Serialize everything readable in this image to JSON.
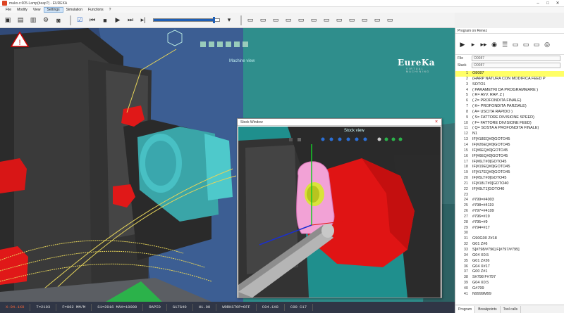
{
  "window": {
    "title": "mako.c:605-Lamp(beap?) - EUREKA"
  },
  "menu": [
    {
      "label": "File",
      "active": false
    },
    {
      "label": "Modify",
      "active": false
    },
    {
      "label": "View",
      "active": false
    },
    {
      "label": "Settings",
      "active": true
    },
    {
      "label": "Simulation",
      "active": false
    },
    {
      "label": "Functions",
      "active": false
    },
    {
      "label": "?",
      "active": false
    }
  ],
  "toolbar": {
    "icons": [
      "folder-open-icon",
      "save-icon",
      "print-icon",
      "settings-icon",
      "camera-icon",
      "check-icon",
      "rewind-icon",
      "stop-icon",
      "play-icon",
      "fast-forward-icon",
      "step-icon"
    ],
    "progress": 0.92,
    "right_icons": [
      "doc-icon",
      "doc-icon",
      "doc-icon",
      "doc-icon",
      "doc-icon",
      "doc-icon",
      "doc-icon",
      "doc-icon",
      "doc-icon",
      "doc-icon",
      "doc-icon",
      "doc-icon"
    ]
  },
  "viewport": {
    "label": "Machine view",
    "logo_brand": "EureKa",
    "logo_sub": "VIRTUAL MACHINING",
    "accent_color": "#2f8e8c"
  },
  "stock_window": {
    "title": "Stock Window",
    "close_label": "×",
    "view_label": "Stock view"
  },
  "status": [
    "X-04.1X0",
    "T=2103",
    "F=862 MM/M",
    "S1=2016 MAX=10000",
    "RAPID",
    "G17G40",
    "H1.00",
    "WORKSTOP=OFF",
    "C04.1X8",
    "C00 C17"
  ],
  "panel": {
    "title": "Program on Renez",
    "file_label": "File",
    "file_value": "O0087",
    "stack_label": "Stack",
    "stack_value": "O0087",
    "code": [
      {
        "n": "1",
        "t": "O8087",
        "current": true
      },
      {
        "n": "2",
        "t": "(HARP NATURA CON MODIFICA FEED P",
        "current": false
      },
      {
        "n": "3",
        "t": "SOTO1",
        "current": false
      },
      {
        "n": "4",
        "t": "( PARAMETRI DA PROGRAMMARE )",
        "current": false
      },
      {
        "n": "5",
        "t": "( R= AVV. RAP. Z )",
        "current": false
      },
      {
        "n": "6",
        "t": "( Z= PROFONDITA FINALE)",
        "current": false
      },
      {
        "n": "7",
        "t": "( K= PROFONDITA PARZIALE)",
        "current": false
      },
      {
        "n": "8",
        "t": "( A= USCITA RAPIDO )",
        "current": false
      },
      {
        "n": "9",
        "t": "( S= FATTORE DIVISIONE SPEED)",
        "current": false
      },
      {
        "n": "10",
        "t": "( F= FATTORE DIVISIONE FEED)",
        "current": false
      },
      {
        "n": "11",
        "t": "( Q= SOSTA A PROFONDITA FINALE)",
        "current": false
      },
      {
        "n": "12",
        "t": "N1",
        "current": false
      },
      {
        "n": "13",
        "t": "IF[#18EQ#0]GOTO45",
        "current": false
      },
      {
        "n": "14",
        "t": "IF[#26EQ#0]GOTO45",
        "current": false
      },
      {
        "n": "15",
        "t": "IF[#6EQ#0]GOTO45",
        "current": false
      },
      {
        "n": "16",
        "t": "IF[#6EQ#0]GOTO45",
        "current": false
      },
      {
        "n": "17",
        "t": "IF[#6LT#0]GOTO45",
        "current": false
      },
      {
        "n": "18",
        "t": "IF[#19EQ#0]GOTO45",
        "current": false
      },
      {
        "n": "19",
        "t": "IF[#17EQ#0]GOTO45",
        "current": false
      },
      {
        "n": "20",
        "t": "IF[#5LT#0]GOTO45",
        "current": false
      },
      {
        "n": "21",
        "t": "IF[#18LT#0]GOTO40",
        "current": false
      },
      {
        "n": "22",
        "t": "IF[#9LT1]GOTO40",
        "current": false
      },
      {
        "n": "23",
        "t": "",
        "current": false
      },
      {
        "n": "24",
        "t": "#799=#4003",
        "current": false
      },
      {
        "n": "25",
        "t": "#798=#4119",
        "current": false
      },
      {
        "n": "26",
        "t": "#797=#4109",
        "current": false
      },
      {
        "n": "27",
        "t": "#796=#19",
        "current": false
      },
      {
        "n": "28",
        "t": "#795=#9",
        "current": false
      },
      {
        "n": "29",
        "t": "#794=#17",
        "current": false
      },
      {
        "n": "30",
        "t": "",
        "current": false
      },
      {
        "n": "31",
        "t": "G90G00 Z#18",
        "current": false
      },
      {
        "n": "32",
        "t": "G01 Z#6",
        "current": false
      },
      {
        "n": "33",
        "t": "S[#798/#796] F[#797/#795]",
        "current": false
      },
      {
        "n": "34",
        "t": "G04 X0.5",
        "current": false
      },
      {
        "n": "35",
        "t": "G01 Z#26",
        "current": false
      },
      {
        "n": "36",
        "t": "G04 X#17",
        "current": false
      },
      {
        "n": "37",
        "t": "G00 Z#1",
        "current": false
      },
      {
        "n": "38",
        "t": "S#798 F#797",
        "current": false
      },
      {
        "n": "39",
        "t": "G04 X0.5",
        "current": false
      },
      {
        "n": "40",
        "t": "G#799",
        "current": false
      },
      {
        "n": "41",
        "t": "N9999M99",
        "current": false
      }
    ],
    "tabs": [
      {
        "label": "Program",
        "active": true
      },
      {
        "label": "Breakpoints",
        "active": false
      },
      {
        "label": "Tool calls",
        "active": false
      }
    ]
  }
}
